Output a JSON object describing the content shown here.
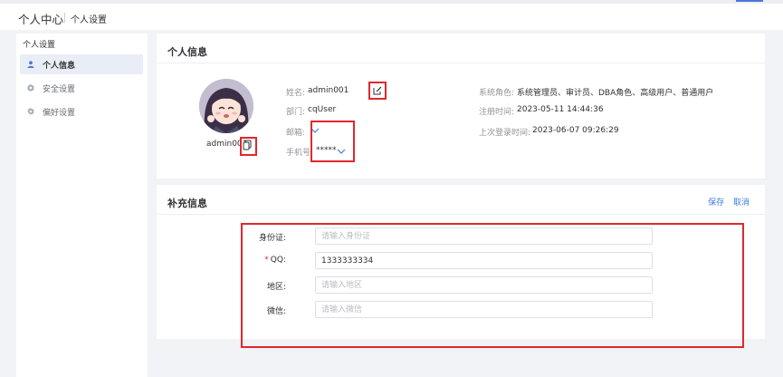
{
  "header": {
    "title": "个人中心",
    "breadcrumb": "个人设置"
  },
  "sidebar": {
    "title": "个人设置",
    "items": [
      {
        "label": "个人信息",
        "icon": "user-icon",
        "active": true
      },
      {
        "label": "安全设置",
        "icon": "shield-icon",
        "active": false
      },
      {
        "label": "偏好设置",
        "icon": "gear-icon",
        "active": false
      }
    ]
  },
  "profile": {
    "card_title": "个人信息",
    "username": "admin001",
    "name_label": "姓名:",
    "name_value": "admin001",
    "dept_label": "部门:",
    "dept_value": "cqUser",
    "email_label": "邮箱:",
    "email_value": "",
    "phone_label": "手机号:",
    "phone_value": "*****",
    "roles_label": "系统角色:",
    "roles_value": "系统管理员、审计员、DBA角色、高级用户、普通用户",
    "register_label": "注册时间:",
    "register_value": "2023-05-11 14:44:36",
    "last_login_label": "上次登录时间:",
    "last_login_value": "2023-06-07 09:26:29"
  },
  "supplement": {
    "card_title": "补充信息",
    "save_label": "保存",
    "cancel_label": "取消",
    "fields": [
      {
        "label": "身份证:",
        "required": false,
        "value": "",
        "placeholder": "请输入身份证"
      },
      {
        "label": "QQ:",
        "required": true,
        "value": "1333333334",
        "placeholder": ""
      },
      {
        "label": "地区:",
        "required": false,
        "value": "",
        "placeholder": "请输入地区"
      },
      {
        "label": "微信:",
        "required": false,
        "value": "",
        "placeholder": "请输入微信"
      }
    ]
  },
  "colors": {
    "accent": "#3d7be6",
    "annotation_red": "#e0282d",
    "page_background": "#f1f3f7",
    "active_menu_background": "#e8edf6"
  }
}
